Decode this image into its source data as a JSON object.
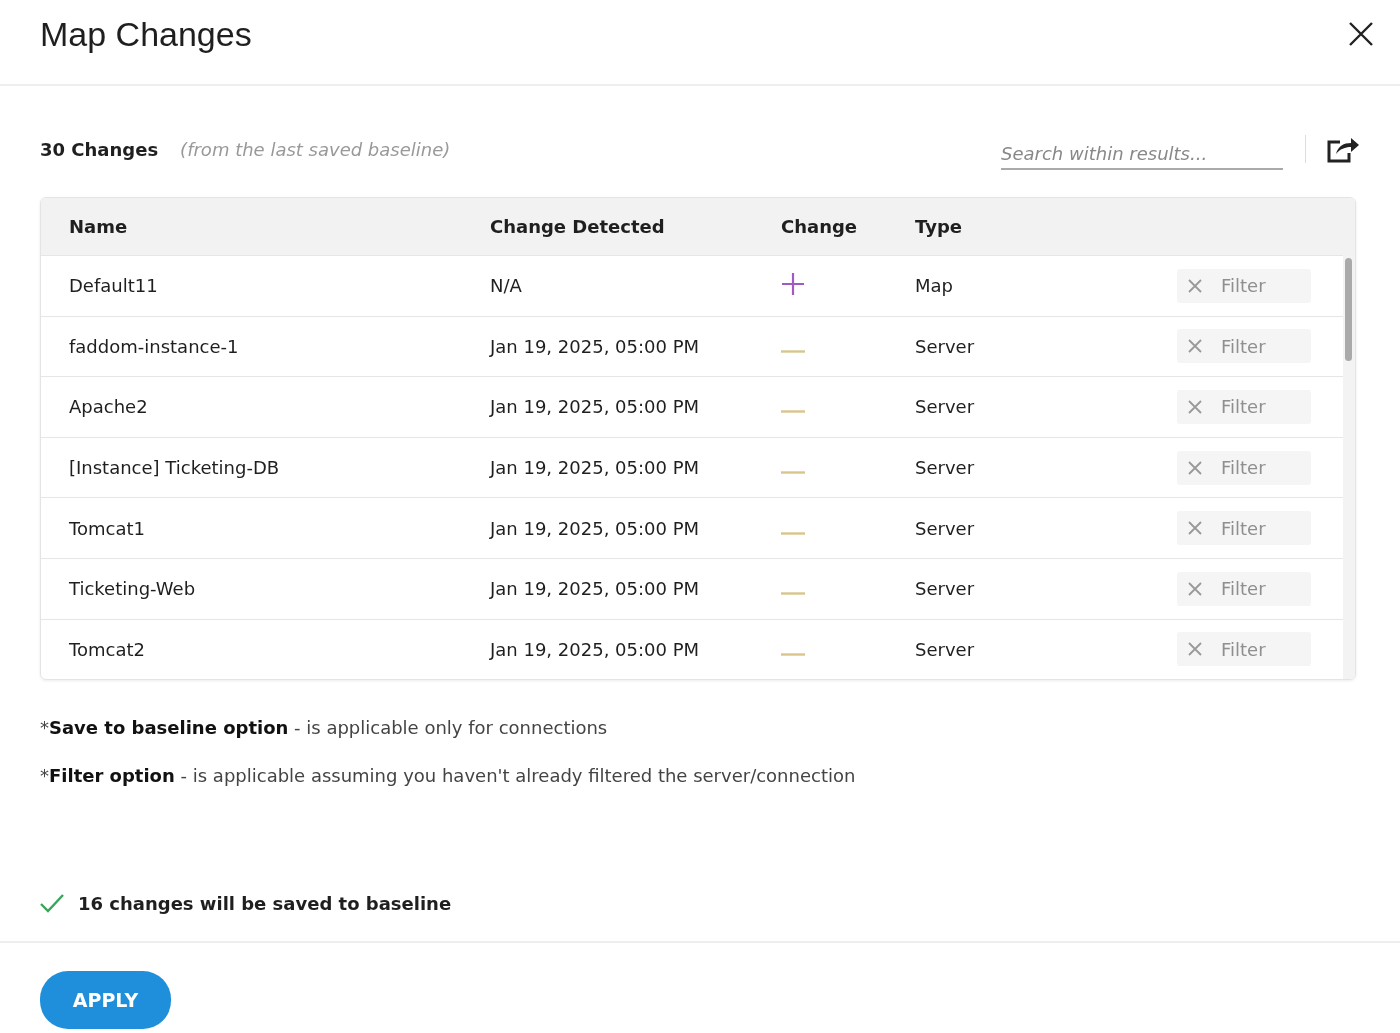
{
  "dialog": {
    "title": "Map Changes"
  },
  "summary": {
    "count": "30 Changes",
    "note": "(from the last saved baseline)"
  },
  "search": {
    "placeholder": "Search within results..."
  },
  "table": {
    "columns": [
      "Name",
      "Change Detected",
      "Change",
      "Type"
    ],
    "rows": [
      {
        "name": "Default11",
        "detected": "N/A",
        "kind": "added",
        "type": "Map",
        "filter_label": "Filter",
        "filter_disabled": true
      },
      {
        "name": "faddom-instance-1",
        "detected": "Jan 19, 2025, 05:00 PM",
        "kind": "removed",
        "type": "Server",
        "filter_label": "Filter",
        "filter_disabled": true
      },
      {
        "name": "Apache2",
        "detected": "Jan 19, 2025, 05:00 PM",
        "kind": "removed",
        "type": "Server",
        "filter_label": "Filter",
        "filter_disabled": true
      },
      {
        "name": "[Instance] Ticketing-DB",
        "detected": "Jan 19, 2025, 05:00 PM",
        "kind": "removed",
        "type": "Server",
        "filter_label": "Filter",
        "filter_disabled": true
      },
      {
        "name": "Tomcat1",
        "detected": "Jan 19, 2025, 05:00 PM",
        "kind": "removed",
        "type": "Server",
        "filter_label": "Filter",
        "filter_disabled": true
      },
      {
        "name": "Ticketing-Web",
        "detected": "Jan 19, 2025, 05:00 PM",
        "kind": "removed",
        "type": "Server",
        "filter_label": "Filter",
        "filter_disabled": true
      },
      {
        "name": "Tomcat2",
        "detected": "Jan 19, 2025, 05:00 PM",
        "kind": "removed",
        "type": "Server",
        "filter_label": "Filter",
        "filter_disabled": true
      }
    ]
  },
  "footnotes": [
    {
      "mark": "*",
      "term": "Save to baseline option",
      "text": " - is applicable only for connections"
    },
    {
      "mark": "*",
      "term": "Filter option",
      "text": " - is applicable assuming you haven't already filtered the server/connection"
    }
  ],
  "status": {
    "text": "16 changes will be saved to baseline"
  },
  "buttons": [
    "APPLY"
  ]
}
